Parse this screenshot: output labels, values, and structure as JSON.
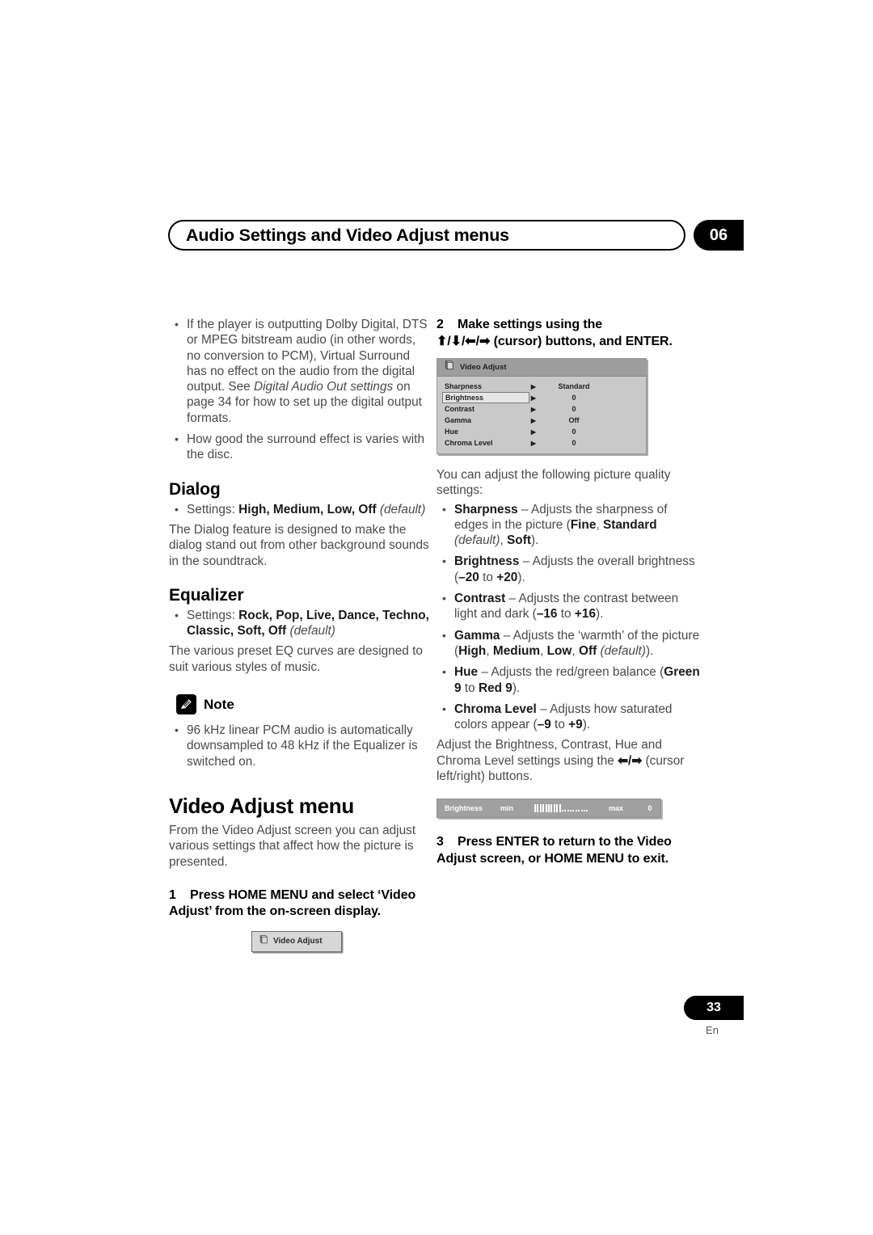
{
  "header": {
    "title": "Audio Settings and Video Adjust menus",
    "chapter": "06"
  },
  "left_column": {
    "intro_bullets": [
      "If the player is outputting Dolby Digital, DTS or MPEG bitstream audio (in other words, no conversion to PCM), Virtual Surround has no effect on the audio from the digital output. See Digital Audio Out settings on page 34 for how to set up the digital output formats.",
      "How good the surround effect is varies with the disc."
    ],
    "intro_bullet_1_pre": "If the player is outputting Dolby Digital, DTS or MPEG bitstream audio (in other words, no conversion to PCM), Virtual Surround has no effect on the audio from the digital output. See ",
    "intro_bullet_1_italic": "Digital Audio Out settings",
    "intro_bullet_1_post": " on page 34 for how to set up the digital output formats.",
    "intro_bullet_2": "How good the surround effect is varies with the disc.",
    "dialog": {
      "heading": "Dialog",
      "settings_label": "Settings: ",
      "settings_values": "High, Medium, Low, Off",
      "settings_default": "(default)",
      "body": "The Dialog feature is designed to make the dialog stand out from other background sounds in the soundtrack."
    },
    "equalizer": {
      "heading": "Equalizer",
      "settings_label": "Settings: ",
      "settings_values": "Rock, Pop, Live, Dance, Techno, Classic, Soft, Off",
      "settings_default": "(default)",
      "body": "The various preset EQ curves are designed to suit various styles of music."
    },
    "note": {
      "label": "Note",
      "icon": "pencil-icon",
      "bullet": "96 kHz linear PCM audio is automatically downsampled to 48 kHz if the Equalizer is switched on."
    },
    "video_adjust_menu": {
      "heading": "Video Adjust menu",
      "body": "From the Video Adjust screen you can adjust various settings that affect how the picture is presented.",
      "step_number": "1",
      "step_text": "Press HOME MENU and select ‘Video Adjust’ from the on-screen display.",
      "chip_label": "Video Adjust",
      "chip_icon": "disc-card-icon"
    }
  },
  "right_column": {
    "step2": {
      "number": "2",
      "line1": "Make settings using the",
      "line2_arrows": "⬆/⬇/⬅/➡",
      "line2_rest": " (cursor) buttons, and ENTER."
    },
    "osd_panel": {
      "title": "Video Adjust",
      "title_icon": "disc-card-icon",
      "arrow_glyph": "▶",
      "rows": [
        {
          "name": "Sharpness",
          "value": "Standard",
          "selected": false
        },
        {
          "name": "Brightness",
          "value": "0",
          "selected": true
        },
        {
          "name": "Contrast",
          "value": "0",
          "selected": false
        },
        {
          "name": "Gamma",
          "value": "Off",
          "selected": false
        },
        {
          "name": "Hue",
          "value": "0",
          "selected": false
        },
        {
          "name": "Chroma Level",
          "value": "0",
          "selected": false
        }
      ]
    },
    "intro": "You can adjust the following picture quality settings:",
    "settings_bullets": [
      {
        "term": "Sharpness",
        "dash": " – ",
        "text_1": "Adjusts the sharpness of edges in the picture (",
        "bold_1": "Fine",
        "sep_1": ", ",
        "bold_2": "Standard",
        "italic_1": " (default)",
        "sep_2": ", ",
        "bold_3": "Soft",
        "text_end": ")."
      },
      {
        "term": "Brightness",
        "dash": " – ",
        "text_1": "Adjusts the overall brightness (",
        "bold_1": "–20",
        "sep_1": " to ",
        "bold_2": "+20",
        "text_end": ")."
      },
      {
        "term": "Contrast",
        "dash": " – ",
        "text_1": "Adjusts the contrast between light and dark (",
        "bold_1": "–16",
        "sep_1": " to ",
        "bold_2": "+16",
        "text_end": ")."
      },
      {
        "term": "Gamma",
        "dash": " – ",
        "text_1": "Adjusts the ‘warmth’ of the picture (",
        "bold_1": "High",
        "sep_1": ", ",
        "bold_2": "Medium",
        "sep_2": ", ",
        "bold_3": "Low",
        "sep_3": ", ",
        "bold_4": "Off",
        "italic_1": " (default)",
        "text_end": ")."
      },
      {
        "term": "Hue",
        "dash": " – ",
        "text_1": "Adjusts the red/green balance (",
        "bold_1": "Green 9",
        "sep_1": " to ",
        "bold_2": "Red 9",
        "text_end": ")."
      },
      {
        "term": "Chroma Level",
        "dash": " – ",
        "text_1": "Adjusts how saturated colors appear (",
        "bold_1": "–9",
        "sep_1": " to ",
        "bold_2": "+9",
        "text_end": ")."
      }
    ],
    "adjust_note_pre": "Adjust the Brightness, Contrast, Hue and Chroma Level settings using the ",
    "adjust_note_arrows": "⬅/➡",
    "adjust_note_post": " (cursor left/right) buttons.",
    "slider": {
      "name": "Brightness",
      "min_label": "min",
      "max_label": "max",
      "value": "0",
      "ticks_on": 10,
      "ticks_off": 10
    },
    "step3": {
      "number": "3",
      "text": "Press ENTER to return to the Video Adjust screen, or HOME MENU to exit."
    }
  },
  "footer": {
    "page_number": "33",
    "language": "En"
  }
}
